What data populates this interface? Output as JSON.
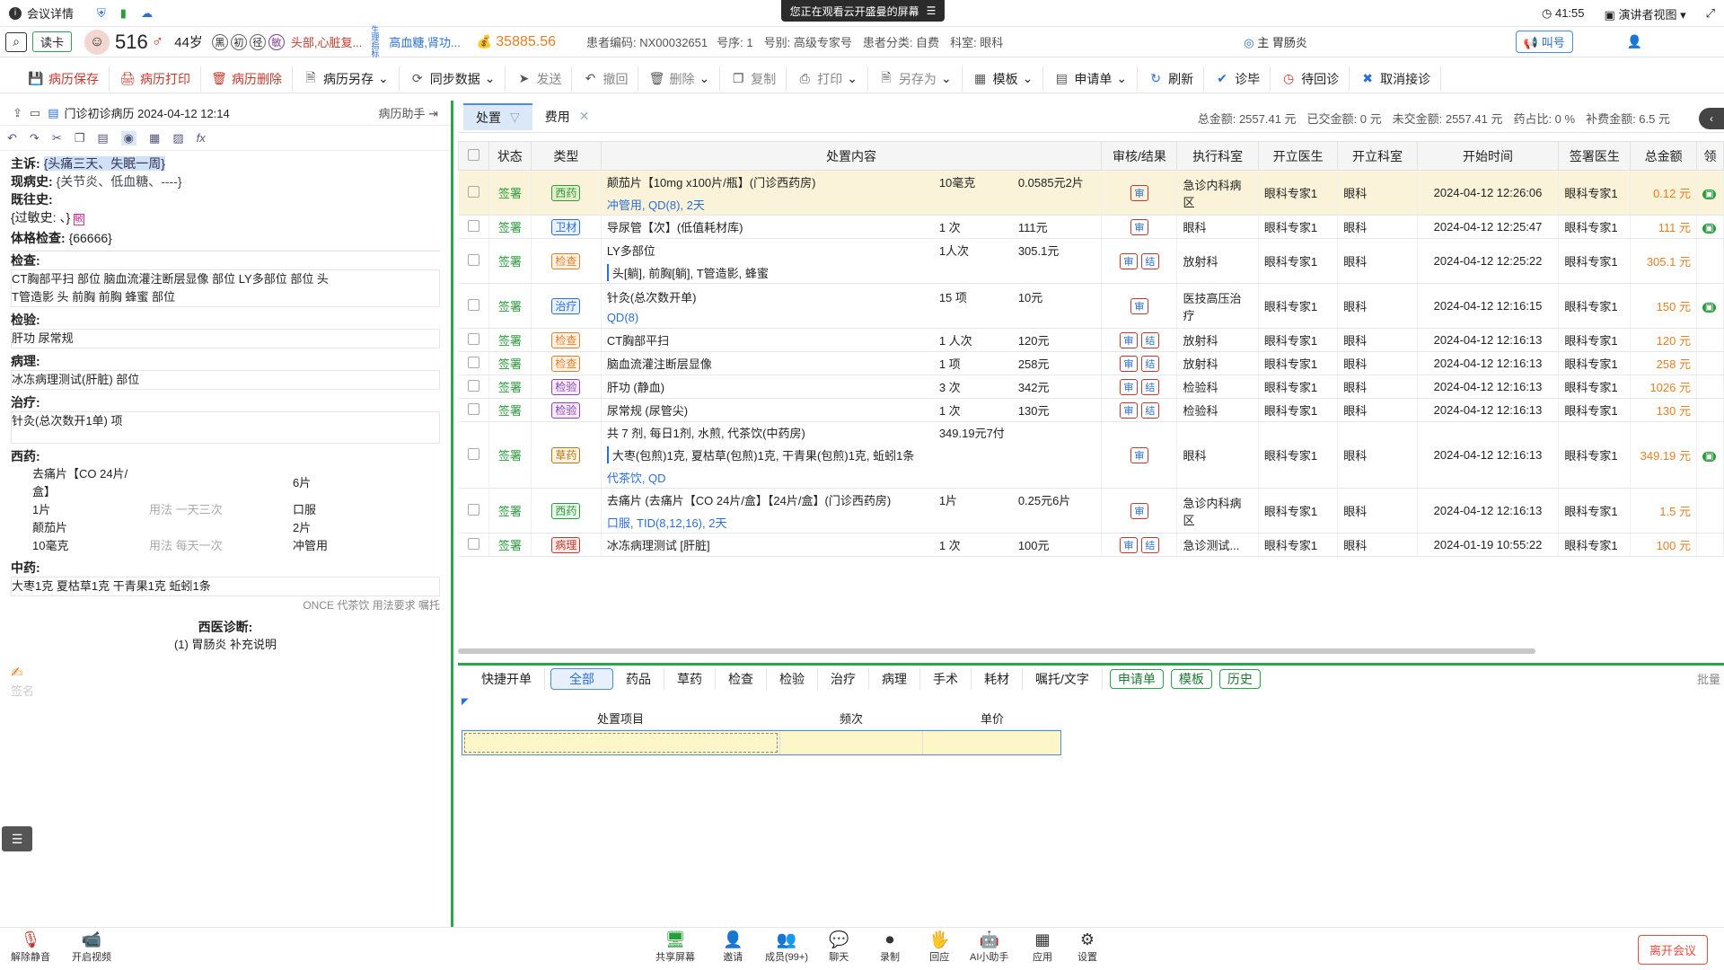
{
  "topbar": {
    "meeting_details": "会议详情",
    "share_banner": "您正在观看云开盛曼的屏幕",
    "time": "41:55",
    "view_label": "演讲者视图"
  },
  "patient": {
    "reader": "读卡",
    "number": "516",
    "gender_symbol": "♂",
    "age": "44岁",
    "chips": [
      "黑",
      "初",
      "径",
      "敏"
    ],
    "chief_tags": "头部,心脏复...",
    "vital_label": "生理指标",
    "vital_text": "高血糖,肾功...",
    "balance": "35885.56",
    "code": "患者编码: NX00032651",
    "seq": "号序: 1",
    "reg_type": "号别: 高级专家号",
    "category": "患者分类: 自费",
    "department": "科室: 眼科",
    "diagnosis_badge": "主 胃肠炎",
    "call_button": "叫号"
  },
  "toolbar": [
    {
      "label": "病历保存",
      "icon": "save-icon"
    },
    {
      "label": "病历打印",
      "icon": "print-icon"
    },
    {
      "label": "病历删除",
      "icon": "delete-icon"
    },
    {
      "label": "病历另存",
      "icon": "save-as-icon"
    },
    {
      "label": "同步数据",
      "icon": "sync-icon"
    },
    {
      "label": "发送",
      "icon": "send-icon"
    },
    {
      "label": "撤回",
      "icon": "undo-icon"
    },
    {
      "label": "删除",
      "icon": "trash-icon"
    },
    {
      "label": "复制",
      "icon": "copy-icon"
    },
    {
      "label": "打印",
      "icon": "printer-icon"
    },
    {
      "label": "另存为",
      "icon": "save-as-icon"
    },
    {
      "label": "模板",
      "icon": "template-icon"
    },
    {
      "label": "申请单",
      "icon": "form-icon"
    },
    {
      "label": "刷新",
      "icon": "refresh-icon"
    },
    {
      "label": "诊毕",
      "icon": "check-icon"
    },
    {
      "label": "待回诊",
      "icon": "clock-icon"
    },
    {
      "label": "取消接诊",
      "icon": "cancel-icon"
    }
  ],
  "emr": {
    "title": "门诊初诊病历 2024-04-12 12:14",
    "assistant": "病历助手",
    "chief_label": "主诉:",
    "chief": "{头痛三天、失眠一周}",
    "present_label": "现病史:",
    "present": "{关节炎、低血糖、----}",
    "past_label": "既往史:",
    "allergy": "{过敏史: 、}",
    "exam_label": "体格检查:",
    "exam": "{66666}",
    "check_label": "检查:",
    "check_lines": [
      "CT胸部平扫 部位    脑血流灌注断层显像 部位    LY多部位 部位   头",
      "T管造影 头    前胸 前胸    蜂蜜 部位"
    ],
    "lab_label": "检验:",
    "lab": "肝功    尿常规",
    "path_label": "病理:",
    "path": "冰冻病理测试(肝脏) 部位",
    "treat_label": "治疗:",
    "treat": "针灸(总次数开1单)                    项",
    "west_label": "西药:",
    "west_rows": [
      [
        "去痛片【CO 24片/盒】",
        "",
        "6片"
      ],
      [
        "1片",
        "用法 一天三次",
        "口服"
      ],
      [
        "颠茄片",
        "",
        "2片"
      ],
      [
        "10毫克",
        "用法 每天一次",
        "冲管用"
      ]
    ],
    "chinese_label": "中药:",
    "chinese": "大枣1克    夏枯草1克    干青果1克    蚯蚓1条",
    "chinese_sub": "ONCE 代茶饮 用法要求 嘱托",
    "diag_label": "西医诊断:",
    "diag": "(1) 胃肠炎 补充说明",
    "sign": "签名"
  },
  "right_tabs": {
    "treatment": "处置",
    "fee": "费用"
  },
  "summary": {
    "total": "总金额: 2557.41 元",
    "paid": "已交金额: 0 元",
    "unpaid": "未交金额: 2557.41 元",
    "drug_ratio": "药占比: 0 %",
    "sub_fee": "补费金额: 6.5 元"
  },
  "columns": [
    "状态",
    "类型",
    "处置内容",
    "",
    "",
    "审核/结果",
    "执行科室",
    "开立医生",
    "开立科室",
    "开始时间",
    "签署医生",
    "总金额",
    "领"
  ],
  "rows": [
    {
      "status": "签署",
      "type": "西药",
      "tc": "#2a9d3b",
      "name": "颠茄片【10mg x100片/瓶】(门诊西药房)",
      "sub": "冲管用, QD(8), 2天",
      "qty": "10毫克",
      "price": "0.0585元2片",
      "dept": "急诊内科病区",
      "doc": "眼科专家1",
      "odept": "眼科",
      "time": "2024-04-12 12:26:06",
      "sign": "眼科专家1",
      "amount": "0.12 元",
      "highlight": true
    },
    {
      "status": "签署",
      "type": "卫材",
      "tc": "#2b6fd6",
      "name": "导尿管【次】(低值耗材库)",
      "sub": "",
      "qty": "1 次",
      "price": "111元",
      "dept": "眼科",
      "doc": "眼科专家1",
      "odept": "眼科",
      "time": "2024-04-12 12:25:47",
      "sign": "眼科专家1",
      "amount": "111 元"
    },
    {
      "status": "签署",
      "type": "检查",
      "tc": "#e67e22",
      "name": "LY多部位",
      "sub": "头[躺], 前胸[躺], T管造影, 蜂蜜",
      "qty": "1人次",
      "price": "305.1元",
      "dept": "放射科",
      "doc": "眼科专家1",
      "odept": "眼科",
      "time": "2024-04-12 12:25:22",
      "sign": "眼科专家1",
      "amount": "305.1 元"
    },
    {
      "status": "签署",
      "type": "治疗",
      "tc": "#2b6fd6",
      "name": "针灸(总次数开单)",
      "sub": "QD(8)",
      "qty": "15 项",
      "price": "10元",
      "dept": "医技高压治疗",
      "doc": "眼科专家1",
      "odept": "眼科",
      "time": "2024-04-12 12:16:15",
      "sign": "眼科专家1",
      "amount": "150 元"
    },
    {
      "status": "签署",
      "type": "检查",
      "tc": "#e67e22",
      "name": "CT胸部平扫",
      "sub": "",
      "qty": "1 人次",
      "price": "120元",
      "dept": "放射科",
      "doc": "眼科专家1",
      "odept": "眼科",
      "time": "2024-04-12 12:16:13",
      "sign": "眼科专家1",
      "amount": "120 元"
    },
    {
      "status": "签署",
      "type": "检查",
      "tc": "#e67e22",
      "name": "脑血流灌注断层显像",
      "sub": "",
      "qty": "1 项",
      "price": "258元",
      "dept": "放射科",
      "doc": "眼科专家1",
      "odept": "眼科",
      "time": "2024-04-12 12:16:13",
      "sign": "眼科专家1",
      "amount": "258 元"
    },
    {
      "status": "签署",
      "type": "检验",
      "tc": "#8e44ad",
      "name": "肝功 (静血)",
      "sub": "",
      "qty": "3 次",
      "price": "342元",
      "dept": "检验科",
      "doc": "眼科专家1",
      "odept": "眼科",
      "time": "2024-04-12 12:16:13",
      "sign": "眼科专家1",
      "amount": "1026 元"
    },
    {
      "status": "签署",
      "type": "检验",
      "tc": "#8e44ad",
      "name": "尿常规 (尿管尖)",
      "sub": "",
      "qty": "1 次",
      "price": "130元",
      "dept": "检验科",
      "doc": "眼科专家1",
      "odept": "眼科",
      "time": "2024-04-12 12:16:13",
      "sign": "眼科专家1",
      "amount": "130 元"
    },
    {
      "status": "签署",
      "type": "草药",
      "tc": "#b9770e",
      "name": "共 7 剂, 每日1剂, 水煎, 代茶饮(中药房)",
      "sub": "大枣(包煎)1克, 夏枯草(包煎)1克, 干青果(包煎)1克, 蚯蚓1条",
      "sub2": "代茶饮, QD",
      "qty": "349.19元7付",
      "price": "",
      "dept": "眼科",
      "doc": "眼科专家1",
      "odept": "眼科",
      "time": "2024-04-12 12:16:13",
      "sign": "眼科专家1",
      "amount": "349.19 元"
    },
    {
      "status": "签署",
      "type": "西药",
      "tc": "#2a9d3b",
      "name": "去痛片 (去痛片【CO 24片/盒】【24片/盒】(门诊西药房)",
      "sub": "口服, TID(8,12,16), 2天",
      "qty": "1片",
      "price": "0.25元6片",
      "dept": "急诊内科病区",
      "doc": "眼科专家1",
      "odept": "眼科",
      "time": "2024-04-12 12:16:13",
      "sign": "眼科专家1",
      "amount": "1.5 元"
    },
    {
      "status": "签署",
      "type": "病理",
      "tc": "#c0392b",
      "name": "冰冻病理测试 [肝脏]",
      "sub": "",
      "qty": "1 次",
      "price": "100元",
      "dept": "急诊测试...",
      "doc": "眼科专家1",
      "odept": "眼科",
      "time": "2024-01-19 10:55:22",
      "sign": "眼科专家1",
      "amount": "100 元"
    }
  ],
  "quick": {
    "label": "快捷开单",
    "tabs": [
      "全部",
      "药品",
      "草药",
      "检查",
      "检验",
      "治疗",
      "病理",
      "手术",
      "耗材",
      "嘱托/文字"
    ],
    "buttons": [
      "申请单",
      "模板",
      "历史"
    ],
    "batch": "批量",
    "cols": [
      "处置项目",
      "频次",
      "单价"
    ]
  },
  "bottombar": [
    {
      "label": "解除静音",
      "icon": "mic-off-icon"
    },
    {
      "label": "开启视频",
      "icon": "video-off-icon"
    },
    {
      "label": "共享屏幕",
      "icon": "share-screen-icon"
    },
    {
      "label": "邀请",
      "icon": "invite-icon"
    },
    {
      "label": "成员(99+)",
      "icon": "members-icon"
    },
    {
      "label": "聊天",
      "icon": "chat-icon"
    },
    {
      "label": "录制",
      "icon": "record-icon"
    },
    {
      "label": "回应",
      "icon": "reaction-icon"
    },
    {
      "label": "AI小助手",
      "icon": "ai-icon"
    },
    {
      "label": "应用",
      "icon": "apps-icon"
    },
    {
      "label": "设置",
      "icon": "settings-icon"
    }
  ],
  "leave_button": "离开会议"
}
